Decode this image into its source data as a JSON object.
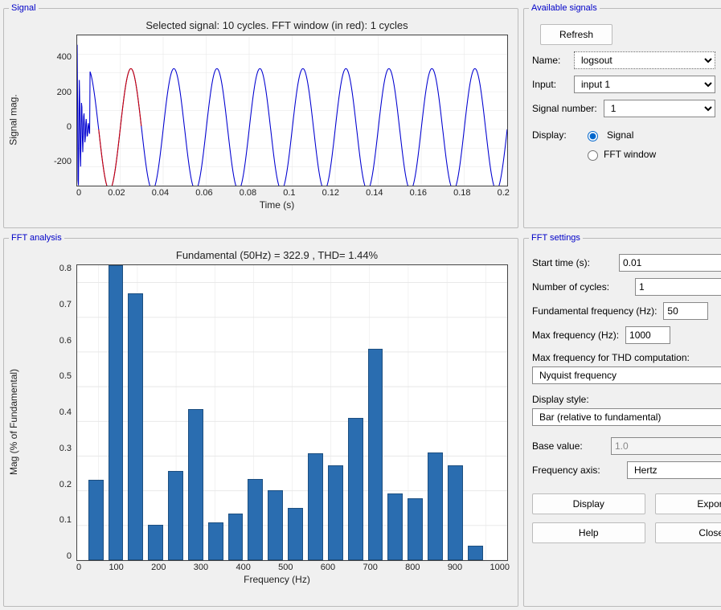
{
  "panels": {
    "signal": "Signal",
    "available": "Available signals",
    "fft_analysis": "FFT analysis",
    "fft_settings": "FFT settings"
  },
  "signal_chart": {
    "title": "Selected signal: 10 cycles. FFT window (in red): 1 cycles",
    "ylabel": "Signal mag.",
    "xlabel": "Time (s)",
    "y_ticks": [
      "400",
      "200",
      "0",
      "-200"
    ],
    "x_ticks": [
      "0",
      "0.02",
      "0.04",
      "0.06",
      "0.08",
      "0.1",
      "0.12",
      "0.14",
      "0.16",
      "0.18",
      "0.2"
    ]
  },
  "chart_data": [
    {
      "type": "line",
      "title": "Selected signal: 10 cycles. FFT window (in red): 1 cycles",
      "xlabel": "Time (s)",
      "ylabel": "Signal mag.",
      "xlim": [
        0,
        0.2
      ],
      "ylim": [
        -300,
        500
      ],
      "x_ticks": [
        0,
        0.02,
        0.04,
        0.06,
        0.08,
        0.1,
        0.12,
        0.14,
        0.16,
        0.18,
        0.2
      ],
      "y_ticks": [
        -200,
        0,
        200,
        400
      ],
      "series": [
        {
          "name": "signal (blue)",
          "amplitude": 323,
          "frequency_hz": 50,
          "phase": 0,
          "cycles": 10,
          "note": "sinusoid over [0,0.2]s with small initial transient spike near t=0"
        },
        {
          "name": "FFT window (red)",
          "t_start": 0.01,
          "t_end": 0.03,
          "note": "highlighted single cycle"
        }
      ]
    },
    {
      "type": "bar",
      "title": "Fundamental (50Hz) = 322.9 , THD= 1.44%",
      "xlabel": "Frequency (Hz)",
      "ylabel": "Mag (% of Fundamental)",
      "xlim": [
        -50,
        1050
      ],
      "ylim": [
        0,
        0.85
      ],
      "x_ticks": [
        0,
        100,
        200,
        300,
        400,
        500,
        600,
        700,
        800,
        900,
        1000
      ],
      "y_ticks": [
        0,
        0.1,
        0.2,
        0.3,
        0.4,
        0.5,
        0.6,
        0.7,
        0.8
      ],
      "categories": [
        0,
        50,
        100,
        150,
        200,
        250,
        300,
        350,
        400,
        450,
        500,
        550,
        600,
        650,
        700,
        750,
        800,
        850,
        900,
        950
      ],
      "values": [
        0.231,
        0.85,
        0.769,
        0.102,
        0.256,
        0.436,
        0.109,
        0.135,
        0.234,
        0.201,
        0.15,
        0.307,
        0.273,
        0.41,
        0.61,
        0.192,
        0.179,
        0.311,
        0.274,
        0.042
      ],
      "note": "bar at 50 Hz appears clipped by y-axis upper limit"
    }
  ],
  "fft_chart": {
    "title": "Fundamental (50Hz) = 322.9 , THD= 1.44%",
    "ylabel": "Mag (% of Fundamental)",
    "xlabel": "Frequency (Hz)",
    "y_ticks": [
      "0.8",
      "0.7",
      "0.6",
      "0.5",
      "0.4",
      "0.3",
      "0.2",
      "0.1",
      "0"
    ],
    "x_ticks": [
      "0",
      "100",
      "200",
      "300",
      "400",
      "500",
      "600",
      "700",
      "800",
      "900",
      "1000"
    ],
    "y_max": 0.85
  },
  "available": {
    "refresh": "Refresh",
    "name_label": "Name:",
    "name_value": "logsout",
    "input_label": "Input:",
    "input_value": "input 1",
    "signum_label": "Signal number:",
    "signum_value": "1",
    "display_label": "Display:",
    "radio_signal": "Signal",
    "radio_fft": "FFT window"
  },
  "settings": {
    "start_label": "Start time (s):",
    "start_value": "0.01",
    "ncycles_label": "Number of cycles:",
    "ncycles_value": "1",
    "fund_label": "Fundamental frequency (Hz):",
    "fund_value": "50",
    "maxfreq_label": "Max frequency (Hz):",
    "maxfreq_value": "1000",
    "thd_label": "Max frequency for THD computation:",
    "thd_value": "Nyquist frequency",
    "style_label": "Display style:",
    "style_value": "Bar (relative to fundamental)",
    "base_label": "Base value:",
    "base_value": "1.0",
    "freqaxis_label": "Frequency axis:",
    "freqaxis_value": "Hertz",
    "btn_display": "Display",
    "btn_export": "Export",
    "btn_help": "Help",
    "btn_close": "Close"
  }
}
